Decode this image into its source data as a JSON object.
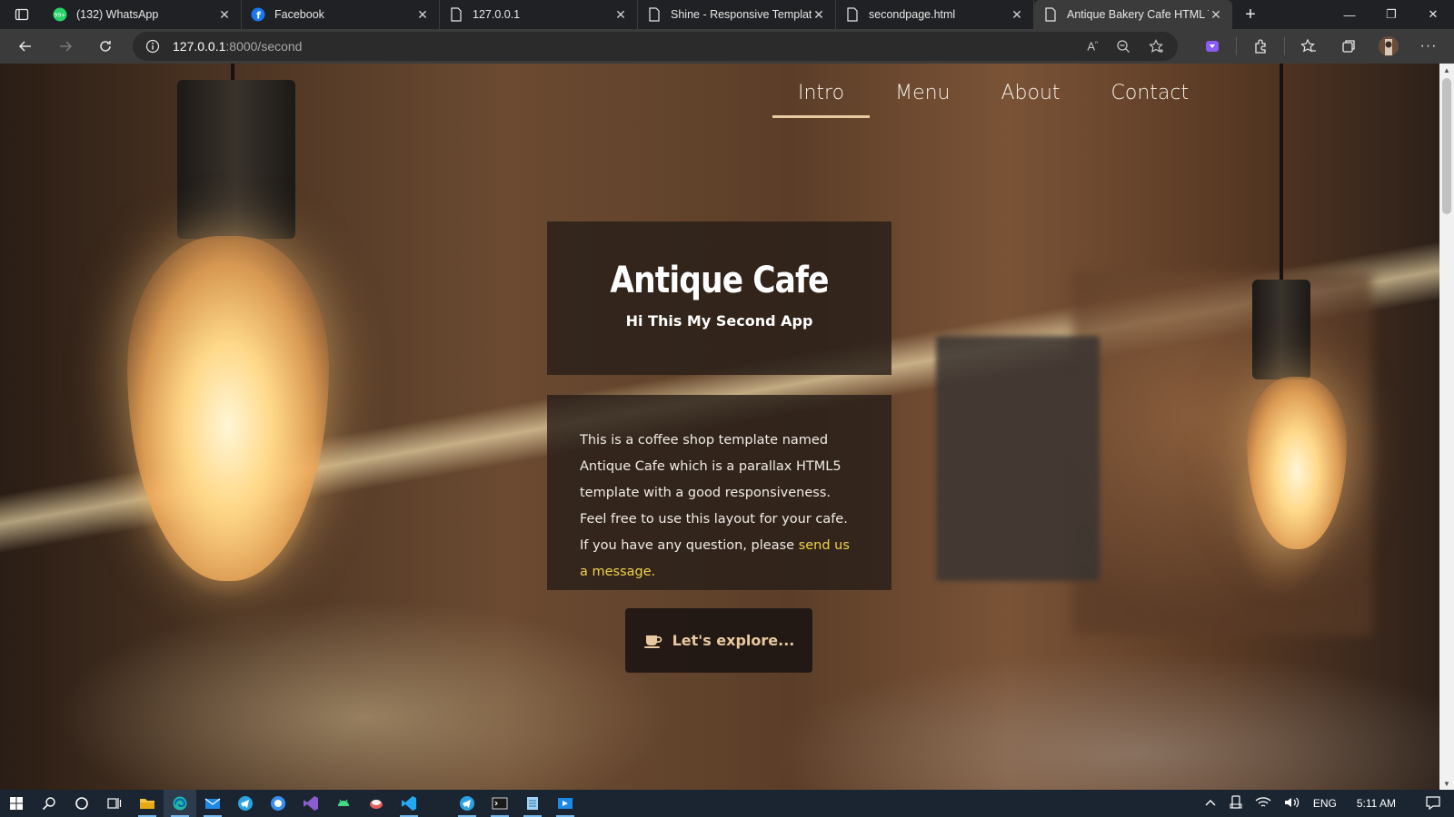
{
  "browser": {
    "tabs": [
      {
        "title": "(132) WhatsApp",
        "icon": "whatsapp-icon"
      },
      {
        "title": "Facebook",
        "icon": "facebook-icon"
      },
      {
        "title": "127.0.0.1",
        "icon": "page-icon"
      },
      {
        "title": "Shine - Responsive Template |",
        "icon": "page-icon"
      },
      {
        "title": "secondpage.html",
        "icon": "page-icon"
      },
      {
        "title": "Antique Bakery Cafe HTML Te",
        "icon": "page-icon",
        "active": true
      }
    ],
    "address": {
      "host": "127.0.0.1",
      "path": ":8000/second"
    }
  },
  "site": {
    "nav": [
      "Intro",
      "Menu",
      "About",
      "Contact"
    ],
    "active_nav": "Intro",
    "hero": {
      "title": "Antique Cafe",
      "subtitle": "Hi This My Second App"
    },
    "description": {
      "text": "This is a coffee shop template named Antique Cafe which is a parallax HTML5 template with a good responsiveness. Feel free to use this layout for your cafe. If you have any question, please ",
      "link": "send us a message."
    },
    "cta": "Let's explore..."
  },
  "taskbar": {
    "language": "ENG",
    "time": "5:11 AM"
  },
  "colors": {
    "accent": "#e8c9a0",
    "link": "#f0d34a",
    "box_bg": "#281e18"
  }
}
